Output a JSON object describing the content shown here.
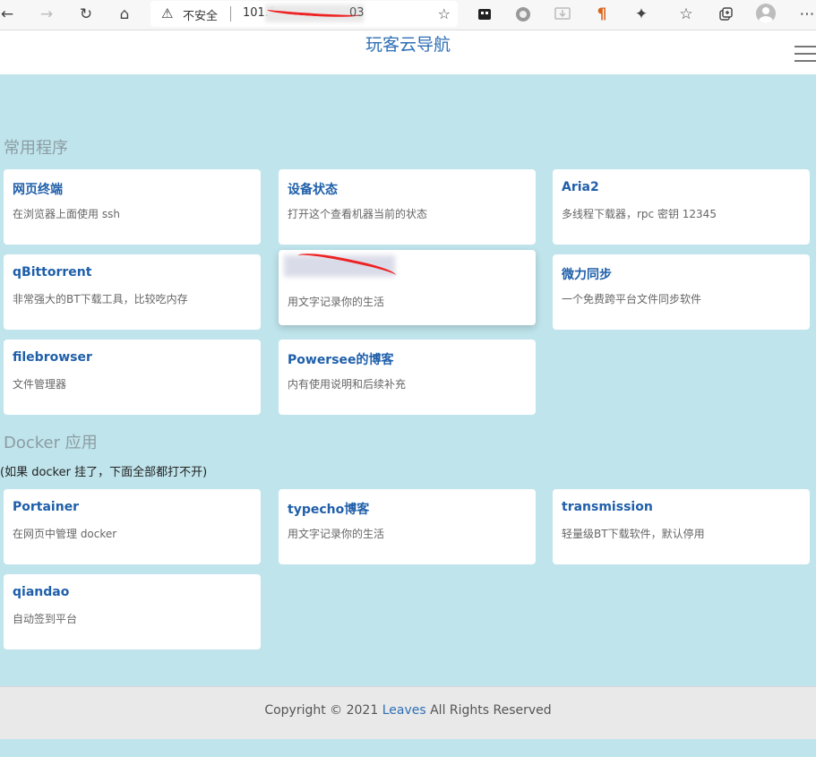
{
  "browser": {
    "security_label": "不安全",
    "url_prefix": "101.3",
    "url_suffix": "03"
  },
  "site": {
    "title": "玩客云导航"
  },
  "sections": {
    "common": {
      "title": "常用程序",
      "cards": [
        {
          "title": "网页终端",
          "desc": "在浏览器上面使用 ssh"
        },
        {
          "title": "设备状态",
          "desc": "打开这个查看机器当前的状态"
        },
        {
          "title": "Aria2",
          "desc": "多线程下载器，rpc 密钥 12345"
        },
        {
          "title": "qBittorrent",
          "desc": "非常强大的BT下载工具，比较吃内存"
        },
        {
          "title": "",
          "desc": "用文字记录你的生活"
        },
        {
          "title": "微力同步",
          "desc": "一个免费跨平台文件同步软件"
        },
        {
          "title": "filebrowser",
          "desc": "文件管理器"
        },
        {
          "title": "Powersee的博客",
          "desc": "内有使用说明和后续补充"
        }
      ]
    },
    "docker": {
      "title": "Docker 应用",
      "note": "(如果 docker 挂了，下面全部都打不开)",
      "cards": [
        {
          "title": "Portainer",
          "desc": "在网页中管理 docker"
        },
        {
          "title": "typecho博客",
          "desc": "用文字记录你的生活"
        },
        {
          "title": "transmission",
          "desc": "轻量级BT下载软件，默认停用"
        },
        {
          "title": "qiandao",
          "desc": "自动签到平台"
        }
      ]
    }
  },
  "footer": {
    "prefix": "Copyright © 2021 ",
    "link": "Leaves",
    "suffix": " All Rights Reserved"
  }
}
